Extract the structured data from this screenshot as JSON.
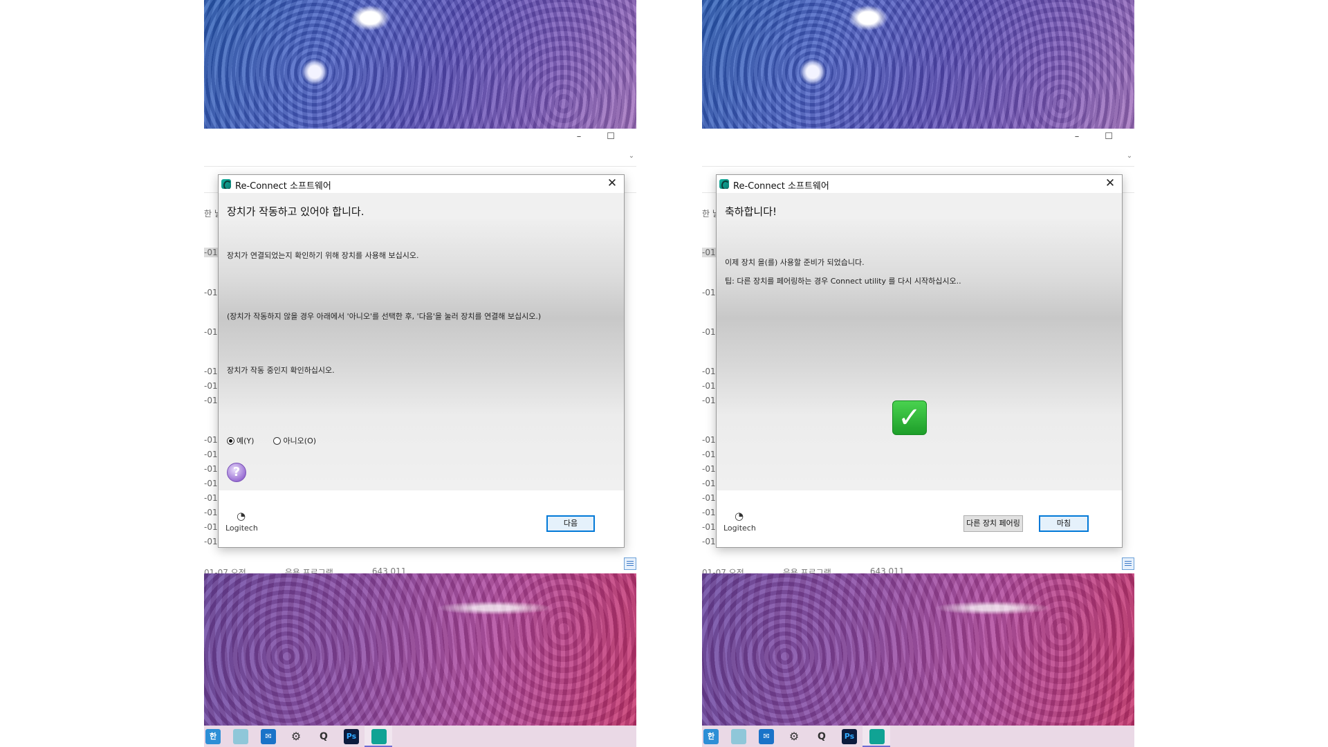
{
  "left": {
    "dialog": {
      "title": "Re-Connect 소프트웨어",
      "heading": "장치가 작동하고 있어야 합니다.",
      "para1": "장치가 연결되었는지 확인하기 위해 장치를 사용해 보십시오.",
      "para2": "(장치가 작동하지 않을 경우 아래에서 '아니오'를 선택한 후, '다음'을 눌러 장치를 연결해 보십시오.)",
      "para3": "장치가 작동 중인지 확인하십시오.",
      "radio_yes": "예(Y)",
      "radio_no": "아니오(O)",
      "radio_selected": "yes",
      "logo": "Logitech",
      "next_button": "다음"
    }
  },
  "right": {
    "dialog": {
      "title": "Re-Connect 소프트웨어",
      "heading": "축하합니다!",
      "para1": "이제 장치  을(를) 사용할 준비가 되었습니다.",
      "para2": "팁: 다른 장치를 페어링하는 경우 Connect utility 를 다시 시작하십시오..",
      "check": "✓",
      "logo": "Logitech",
      "pair_button": "다른 장치 페어링",
      "finish_button": "마침"
    }
  },
  "explorer": {
    "row_text": "-01",
    "side_text": "한 날",
    "footer": [
      "01-07 오전",
      "응용 프로그램",
      "643 011"
    ]
  },
  "taskbar": {
    "icons": [
      {
        "name": "hangul-icon",
        "glyph": "한",
        "color": "#2d8fd6"
      },
      {
        "name": "notepad-icon",
        "glyph": "",
        "color": "#8fc7d9"
      },
      {
        "name": "mail-icon",
        "glyph": "✉",
        "color": "#1a73c8"
      },
      {
        "name": "settings-icon",
        "glyph": "⚙",
        "color": "#3a3a3a"
      },
      {
        "name": "search-icon",
        "glyph": "Q",
        "color": "#3a3a3a"
      },
      {
        "name": "photoshop-icon",
        "glyph": "Ps",
        "color": "#0c1b3d"
      },
      {
        "name": "logitech-connect-icon",
        "glyph": "",
        "color": "#10a394"
      }
    ]
  },
  "colors": {
    "primary_button_border": "#0078d7",
    "check_green": "#2eb83a"
  }
}
